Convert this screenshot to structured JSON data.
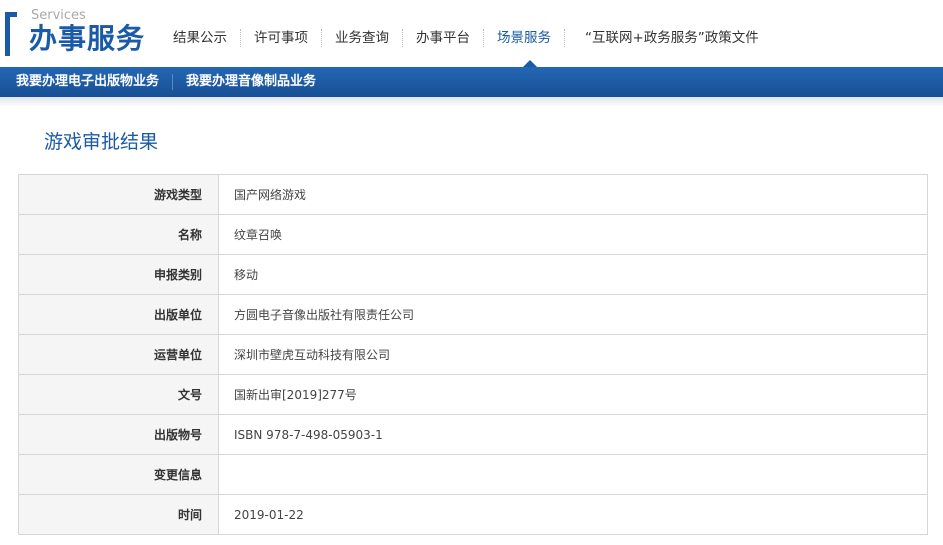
{
  "logo": {
    "en": "Services",
    "cn": "办事服务"
  },
  "nav": {
    "items": [
      "结果公示",
      "许可事项",
      "业务查询",
      "办事平台",
      "场景服务"
    ],
    "active_index": 4,
    "policy": "“互联网+政务服务”政策文件"
  },
  "subnav": [
    "我要办理电子出版物业务",
    "我要办理音像制品业务"
  ],
  "page": {
    "title": "游戏审批结果"
  },
  "table": {
    "rows": [
      {
        "label": "游戏类型",
        "value": "国产网络游戏"
      },
      {
        "label": "名称",
        "value": "纹章召唤"
      },
      {
        "label": "申报类别",
        "value": "移动"
      },
      {
        "label": "出版单位",
        "value": "方圆电子音像出版社有限责任公司"
      },
      {
        "label": "运营单位",
        "value": "深圳市壁虎互动科技有限公司"
      },
      {
        "label": "文号",
        "value": "国新出审[2019]277号"
      },
      {
        "label": "出版物号",
        "value": "ISBN 978-7-498-05903-1"
      },
      {
        "label": "变更信息",
        "value": ""
      },
      {
        "label": "时间",
        "value": "2019-01-22"
      }
    ]
  },
  "colors": {
    "brand": "#1a5aa6",
    "subbar": "#1f5ea8",
    "label_bg": "#f5f5f5",
    "border": "#d6d6d6"
  }
}
